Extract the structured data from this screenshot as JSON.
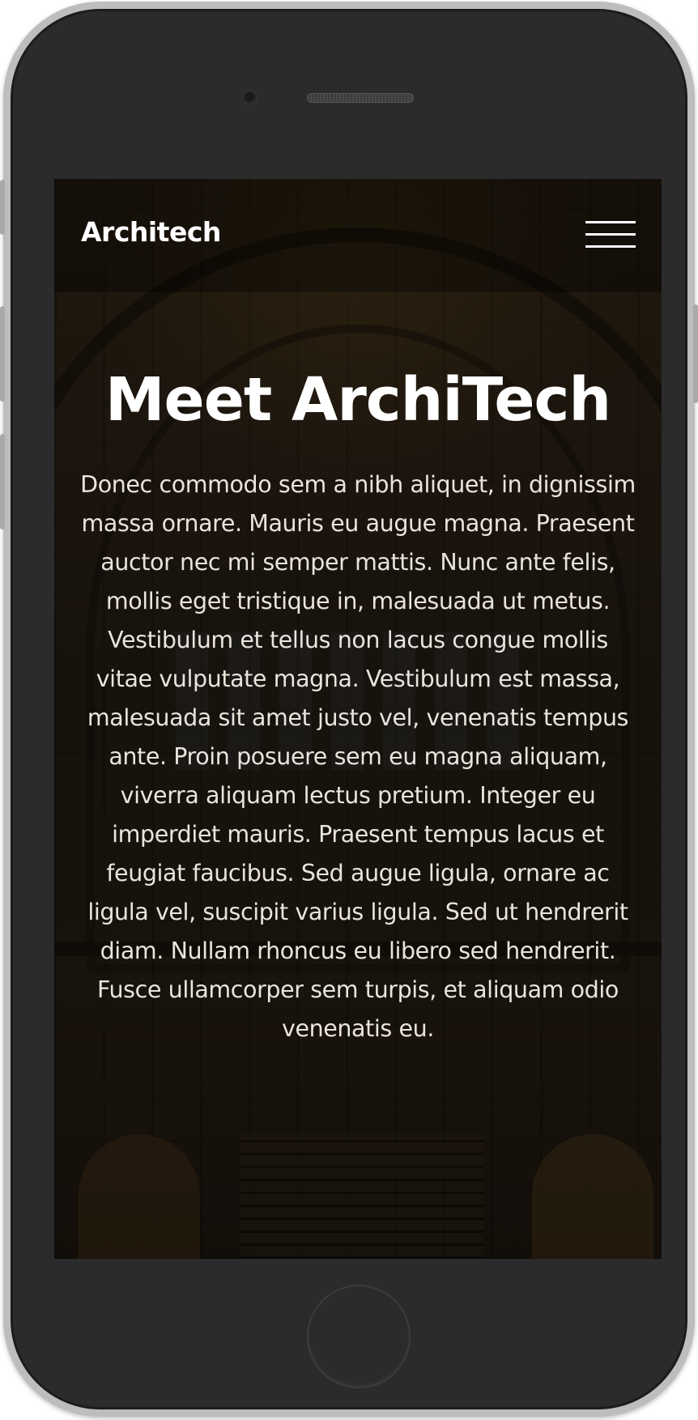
{
  "navbar": {
    "brand": "Architech",
    "menu_icon": "hamburger-menu-icon"
  },
  "hero": {
    "title": "Meet ArchiTech",
    "body": "Donec commodo sem a nibh aliquet, in dignissim massa ornare. Mauris eu augue magna. Praesent auctor nec mi semper mattis. Nunc ante felis, mollis eget tristique in, malesuada ut metus. Vestibulum et tellus non lacus congue mollis vitae vulputate magna. Vestibulum est massa, malesuada sit amet justo vel, venenatis tempus ante. Proin posuere sem eu magna aliquam, viverra aliquam lectus pretium. Integer eu imperdiet mauris. Praesent tempus lacus et feugiat faucibus. Sed augue ligula, ornare ac ligula vel, suscipit varius ligula. Sed ut hendrerit diam. Nullam rhoncus eu libero sed hendrerit. Fusce ullamcorper sem turpis, et aliquam odio venenatis eu."
  },
  "device": {
    "frame_color": "#2b2b2c",
    "bezel_color": "#bdbdbe"
  },
  "colors": {
    "text": "#ffffff",
    "body_text": "#e9e4dc"
  }
}
